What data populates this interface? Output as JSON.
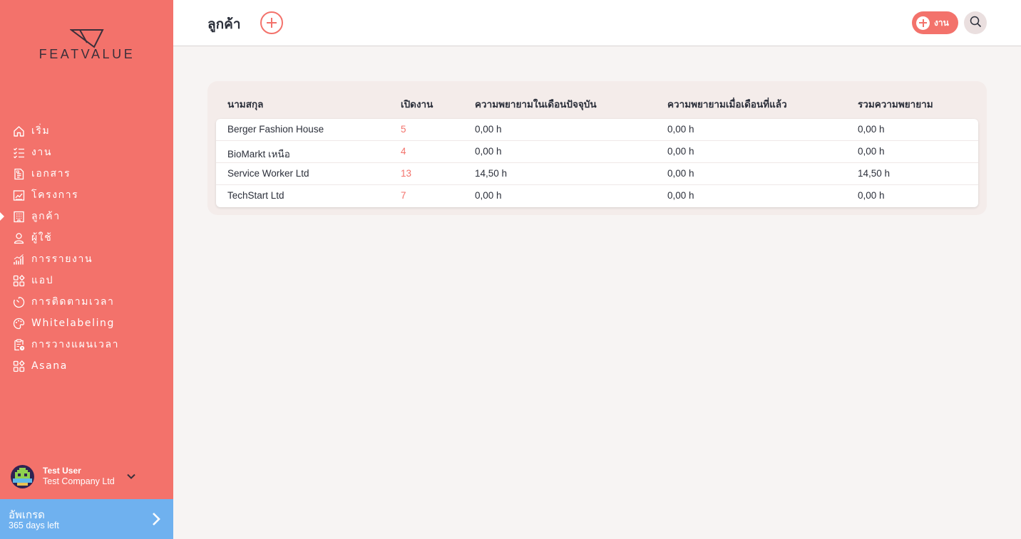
{
  "brand": {
    "name": "FEATVALUE",
    "accent": "#f3726b",
    "upgrade_color": "#6fb1ef"
  },
  "sidebar": {
    "items": [
      {
        "label": "เริ่ม",
        "icon": "home-icon"
      },
      {
        "label": "งาน",
        "icon": "task-list-icon"
      },
      {
        "label": "เอกสาร",
        "icon": "document-icon"
      },
      {
        "label": "โครงการ",
        "icon": "project-chart-icon"
      },
      {
        "label": "ลูกค้า",
        "icon": "building-icon",
        "active": true
      },
      {
        "label": "ผู้ใช้",
        "icon": "user-icon"
      },
      {
        "label": "การรายงาน",
        "icon": "report-icon"
      },
      {
        "label": "แอป",
        "icon": "apps-icon"
      },
      {
        "label": "การติดตามเวลา",
        "icon": "timer-icon"
      },
      {
        "label": "Whitelabeling",
        "icon": "palette-icon"
      },
      {
        "label": "การวางแผนเวลา",
        "icon": "clipboard-clock-icon"
      },
      {
        "label": "Asana",
        "icon": "apps-icon"
      }
    ],
    "user": {
      "name": "Test User",
      "company": "Test Company Ltd"
    },
    "upgrade": {
      "title": "อัพเกรด",
      "subtitle": "365 days left"
    }
  },
  "header": {
    "title": "ลูกค้า",
    "task_button_label": "งาน"
  },
  "table": {
    "columns": [
      "นามสกุล",
      "เปิดงาน",
      "ความพยายามในเดือนปัจจุบัน",
      "ความพยายามเมื่อเดือนที่แล้ว",
      "รวมความพยายาม"
    ],
    "rows": [
      {
        "name": "Berger Fashion House",
        "open": "5",
        "current": "0,00 h",
        "last": "0,00 h",
        "total": "0,00 h"
      },
      {
        "name": "BioMarkt เหนือ",
        "open": "4",
        "current": "0,00 h",
        "last": "0,00 h",
        "total": "0,00 h"
      },
      {
        "name": "Service Worker Ltd",
        "open": "13",
        "current": "14,50 h",
        "last": "0,00 h",
        "total": "14,50 h"
      },
      {
        "name": "TechStart Ltd",
        "open": "7",
        "current": "0,00 h",
        "last": "0,00 h",
        "total": "0,00 h"
      }
    ]
  }
}
